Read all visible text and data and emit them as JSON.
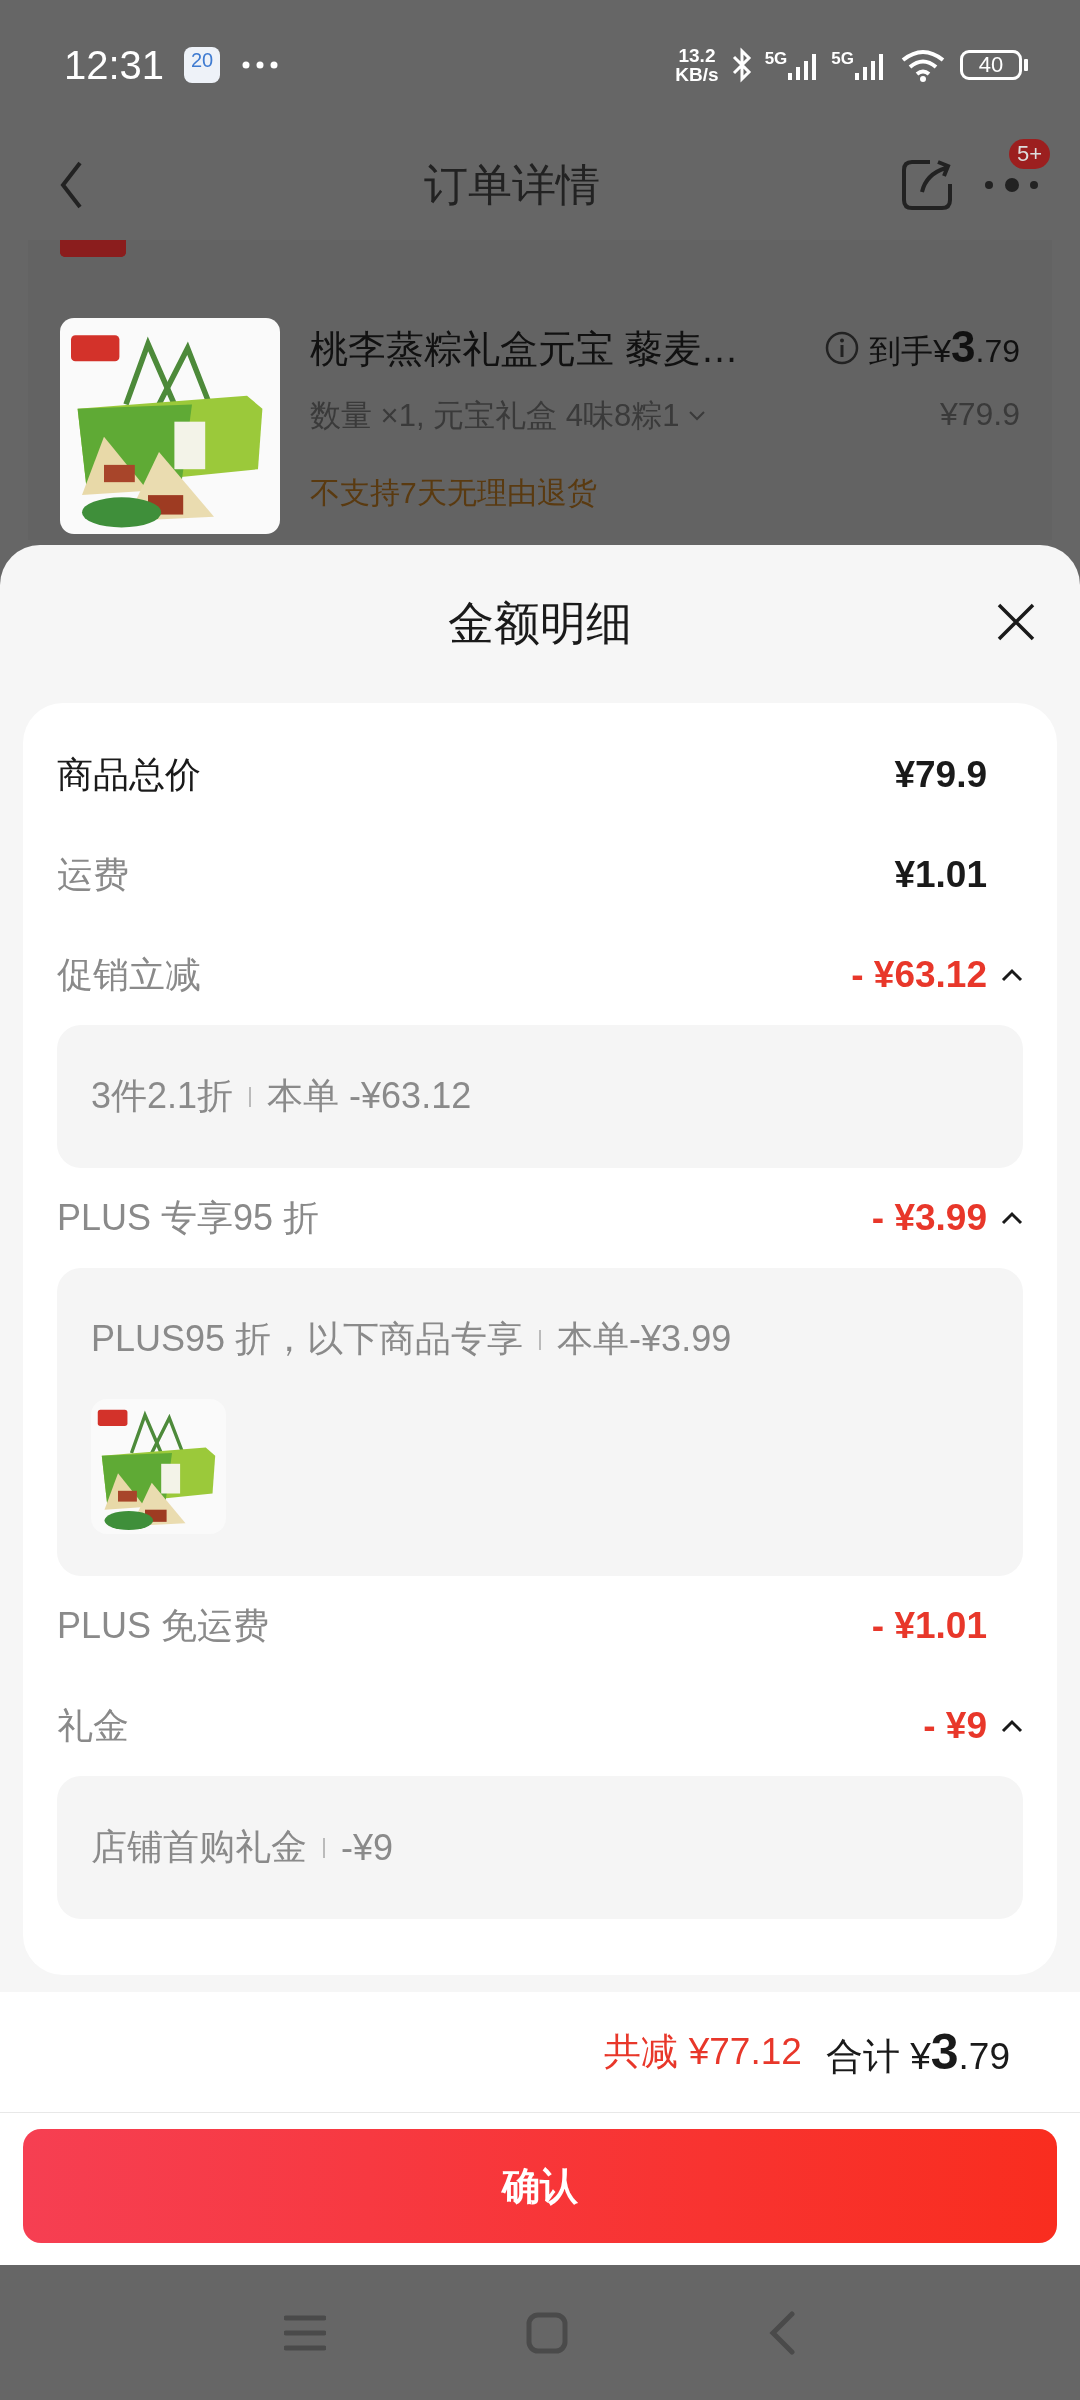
{
  "status_bar": {
    "time": "12:31",
    "calendar_day": "20",
    "speed_value": "13.2",
    "speed_unit": "KB/s",
    "sim_1": "5G",
    "sim_2": "5G",
    "battery": "40"
  },
  "header": {
    "title": "订单详情",
    "badge": "5+"
  },
  "product": {
    "title": "桃李蒸粽礼盒元宝 藜麦…",
    "spec": "数量 ×1, 元宝礼盒 4味8粽1",
    "notice": "不支持7天无理由退货",
    "final_label": "到手",
    "final_price": {
      "currency": "¥",
      "integer": "3",
      "decimal": ".79"
    },
    "price": "¥79.9"
  },
  "sheet": {
    "title": "金额明细",
    "rows": [
      {
        "kind": "total",
        "label": "商品总价",
        "amount": "¥79.9"
      },
      {
        "kind": "fee",
        "label": "运费",
        "amount": "¥1.01"
      },
      {
        "kind": "discount",
        "label": "促销立减",
        "amount": "- ¥63.12",
        "expanded": true,
        "detail": {
          "parts": [
            "3件2.1折",
            "本单 -¥63.12"
          ]
        }
      },
      {
        "kind": "discount",
        "label": "PLUS 专享95 折",
        "amount": "- ¥3.99",
        "expanded": true,
        "detail": {
          "parts": [
            "PLUS95 折，以下商品专享",
            "本单-¥3.99"
          ]
        }
      },
      {
        "kind": "discount",
        "label": "PLUS 免运费",
        "amount": "- ¥1.01"
      },
      {
        "kind": "discount",
        "label": "礼金",
        "amount": "- ¥9",
        "expanded": true,
        "detail": {
          "parts": [
            "店铺首购礼金",
            "-¥9"
          ]
        }
      }
    ]
  },
  "footer": {
    "saving_label": "共减",
    "saving_amount": "¥77.12",
    "total_label": "合计",
    "total_price": {
      "currency": "¥",
      "integer": "3",
      "decimal": ".79"
    }
  },
  "confirm_button": "确认"
}
